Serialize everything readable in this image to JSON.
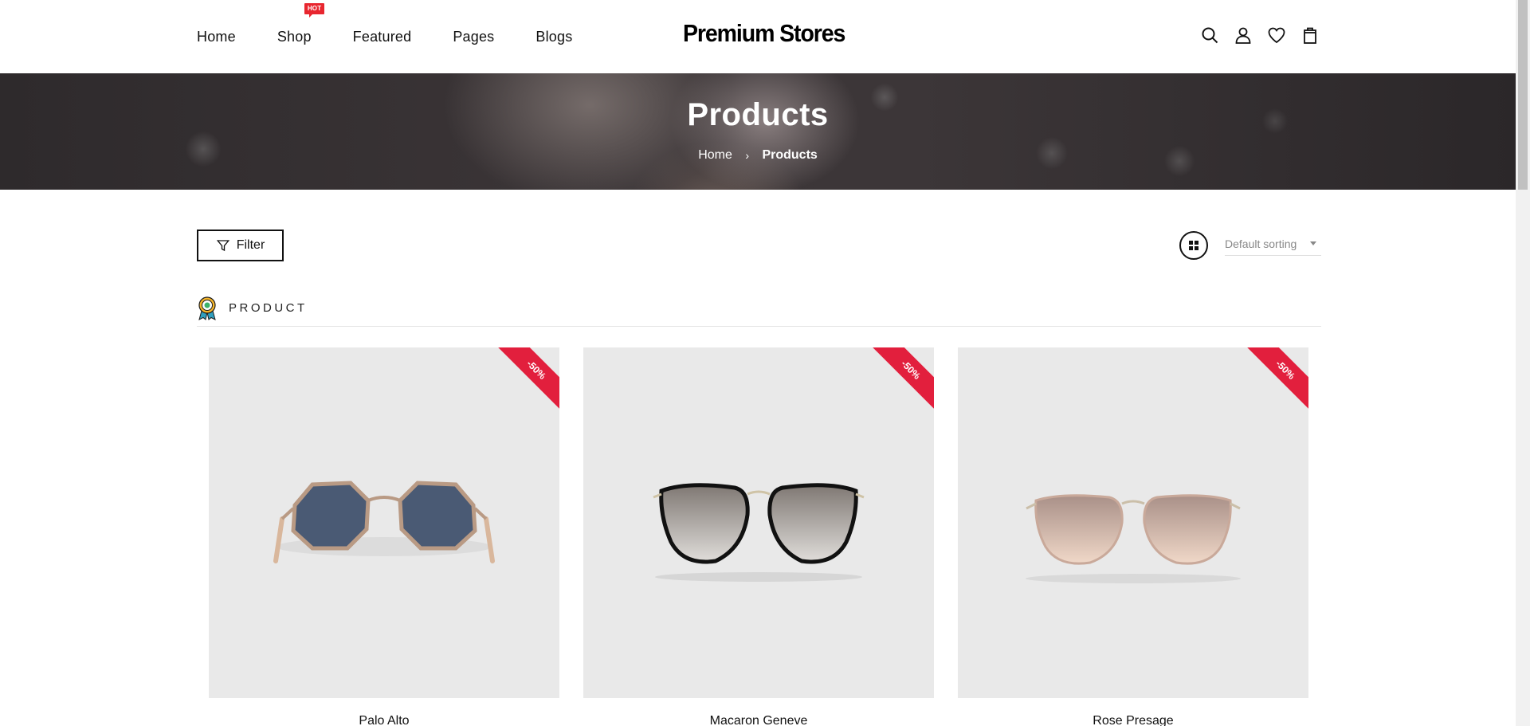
{
  "header": {
    "logo": "Premium Stores",
    "nav": [
      {
        "label": "Home"
      },
      {
        "label": "Shop",
        "badge": "HOT"
      },
      {
        "label": "Featured"
      },
      {
        "label": "Pages"
      },
      {
        "label": "Blogs"
      }
    ],
    "icons": [
      "search-icon",
      "account-icon",
      "wishlist-heart-icon",
      "cart-bag-icon"
    ]
  },
  "banner": {
    "title": "Products",
    "breadcrumb": {
      "home": "Home",
      "separator": "›",
      "current": "Products"
    }
  },
  "toolbar": {
    "filter_label": "Filter",
    "view_icon": "grid-view-icon",
    "sort_selected": "Default sorting"
  },
  "section": {
    "label": "PRODUCT",
    "icon": "award-badge-icon"
  },
  "products": [
    {
      "name": "Palo Alto",
      "discount": "-50%",
      "lens_color": "#4a5a74",
      "frame_color": "#b99a84"
    },
    {
      "name": "Macaron Geneve",
      "discount": "-50%",
      "lens_color": "#8d8783",
      "frame_color": "#111111"
    },
    {
      "name": "Rose Presage",
      "discount": "-50%",
      "lens_color": "#bfa49a",
      "frame_color": "#c9a99a"
    }
  ],
  "colors": {
    "accent_red": "#e21f3d",
    "hot_badge": "#e8262f",
    "product_bg": "#e9e9e9"
  }
}
